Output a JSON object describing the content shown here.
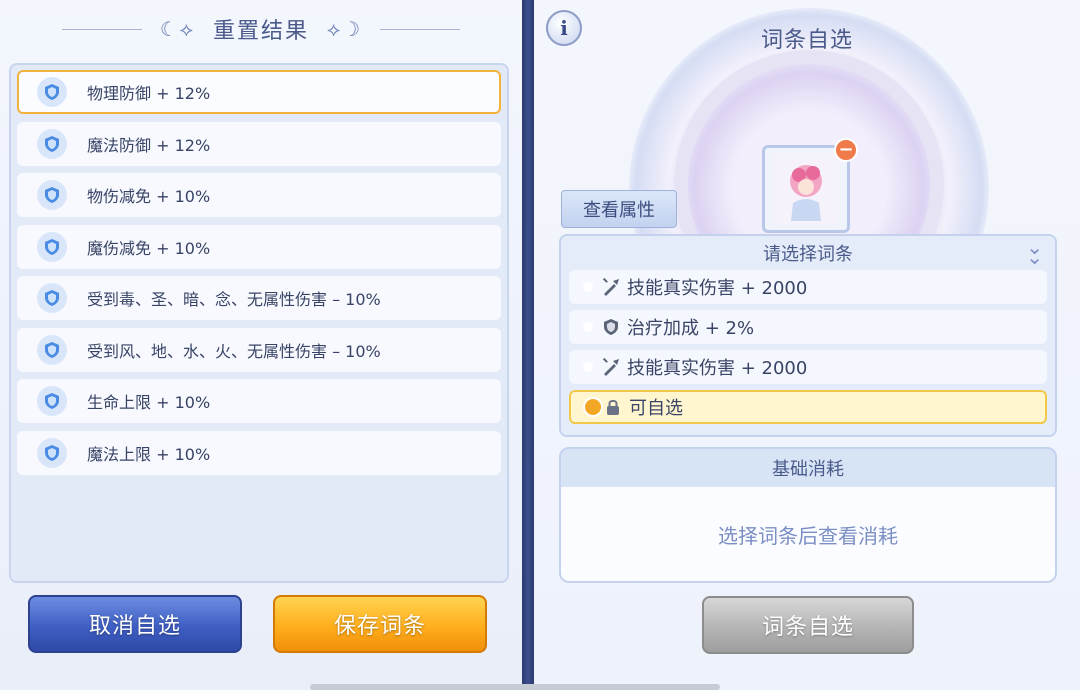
{
  "left_panel": {
    "title": "重置结果",
    "results": [
      {
        "label": "物理防御 + 12%",
        "selected": true
      },
      {
        "label": "魔法防御 + 12%",
        "selected": false
      },
      {
        "label": "物伤减免 + 10%",
        "selected": false
      },
      {
        "label": "魔伤减免 + 10%",
        "selected": false
      },
      {
        "label": "受到毒、圣、暗、念、无属性伤害 – 10%",
        "selected": false
      },
      {
        "label": "受到风、地、水、火、无属性伤害 – 10%",
        "selected": false
      },
      {
        "label": "生命上限 + 10%",
        "selected": false
      },
      {
        "label": "魔法上限 + 10%",
        "selected": false
      }
    ],
    "cancel_button": "取消自选",
    "save_button": "保存词条"
  },
  "right_panel": {
    "title": "词条自选",
    "info_icon": "i",
    "view_attributes_button": "查看属性",
    "select_header": "请选择词条",
    "options": [
      {
        "icon": "sword-icon",
        "label": "技能真实伤害 + 2000",
        "highlight": false
      },
      {
        "icon": "shield-icon",
        "label": "治疗加成 + 2%",
        "highlight": false
      },
      {
        "icon": "sword-icon",
        "label": "技能真实伤害 + 2000",
        "highlight": false
      },
      {
        "icon": "lock-icon",
        "label": "可自选",
        "highlight": true
      }
    ],
    "cost_header": "基础消耗",
    "cost_empty_text": "选择词条后查看消耗",
    "select_button": "词条自选"
  },
  "colors": {
    "selected_border": "#f2b33c",
    "cancel_button": "#3f5fc4",
    "save_button": "#ffae1d",
    "disabled_button": "#b2b2b2",
    "text_primary": "#384466"
  }
}
